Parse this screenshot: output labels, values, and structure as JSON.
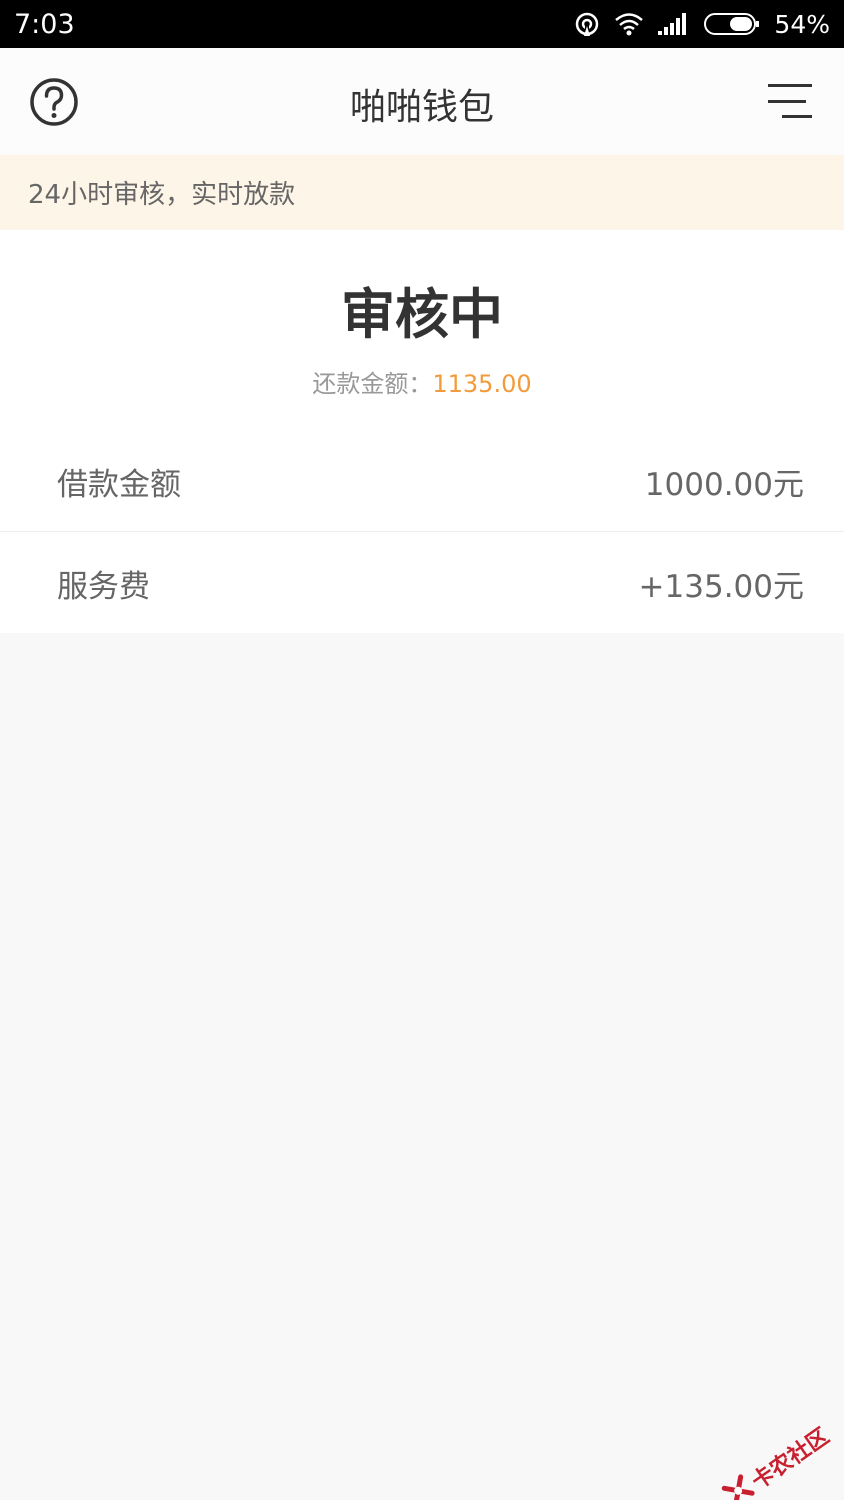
{
  "status_bar": {
    "time": "7:03",
    "battery": "54%",
    "icons": [
      "hotspot-icon",
      "wifi-icon",
      "signal-icon",
      "battery-icon"
    ]
  },
  "header": {
    "title": "啪啪钱包",
    "help_icon": "question-circle-icon",
    "menu_icon": "menu-icon"
  },
  "notice": {
    "text": "24小时审核，实时放款"
  },
  "status": {
    "title": "审核中",
    "repay_label": "还款金额：",
    "repay_amount": "1135.00"
  },
  "details": [
    {
      "label": "借款金额",
      "value": "1000.00元"
    },
    {
      "label": "服务费",
      "value": "+135.00元"
    }
  ],
  "watermark": {
    "text": "卡农社区"
  },
  "colors": {
    "accent_amount": "#f39a3b",
    "notice_bg": "#fdf5e8",
    "watermark": "#c8202f"
  }
}
